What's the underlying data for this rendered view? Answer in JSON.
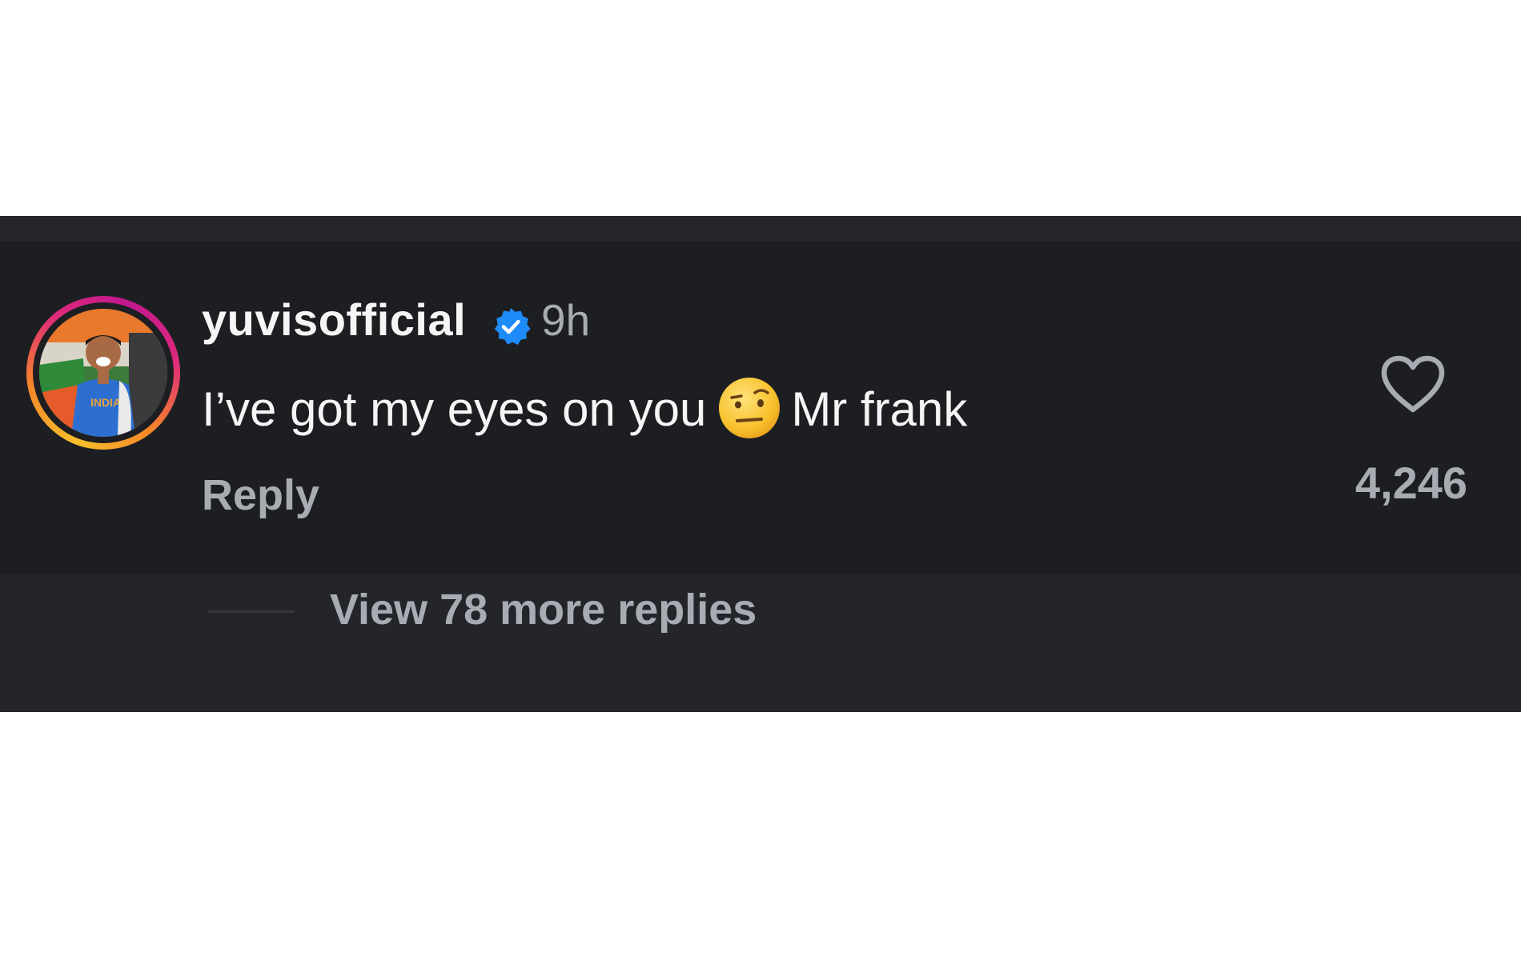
{
  "comment": {
    "username": "yuvisofficial",
    "verified": true,
    "verified_icon": "verified-badge-icon",
    "timestamp": "9h",
    "text_before_emoji": "I’ve got my eyes on you",
    "emoji": "face-with-raised-eyebrow-emoji",
    "text_after_emoji": "Mr frank",
    "reply_label": "Reply",
    "like_icon": "heart-outline-icon",
    "like_count": "4,246",
    "view_replies_label": "View 78 more replies"
  },
  "colors": {
    "panel_background": "#1d1e22",
    "primary_text": "#f5f5f5",
    "secondary_text": "#a8abb2",
    "verified_blue": "#1d8cf8",
    "story_ring": [
      "#f6c02b",
      "#f58529",
      "#dd2a7b",
      "#c2178f"
    ]
  }
}
